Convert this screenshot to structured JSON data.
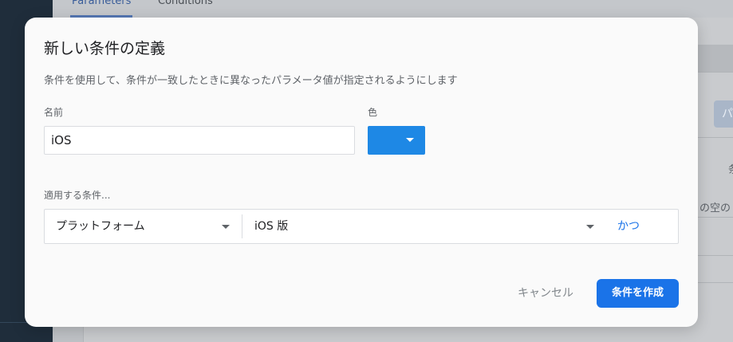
{
  "background": {
    "tabs": [
      {
        "label": "Parameters",
        "active": true
      },
      {
        "label": "Conditions",
        "active": false
      }
    ],
    "chip_label": "パ",
    "right_text_1": "条",
    "right_text_2": "の空の"
  },
  "dialog": {
    "title": "新しい条件の定義",
    "description": "条件を使用して、条件が一致したときに異なったパラメータ値が指定されるようにします",
    "name_label": "名前",
    "name_value": "iOS",
    "color_label": "色",
    "color_value": "#1e88e5",
    "apply_label": "適用する条件...",
    "rule": {
      "attribute": "プラットフォーム",
      "value": "iOS 版",
      "and_label": "かつ"
    },
    "cancel_label": "キャンセル",
    "create_label": "条件を作成"
  },
  "colors": {
    "accent": "#1a73e8",
    "swatch": "#1e88e5"
  },
  "icons": [
    "chevron-down-icon"
  ]
}
